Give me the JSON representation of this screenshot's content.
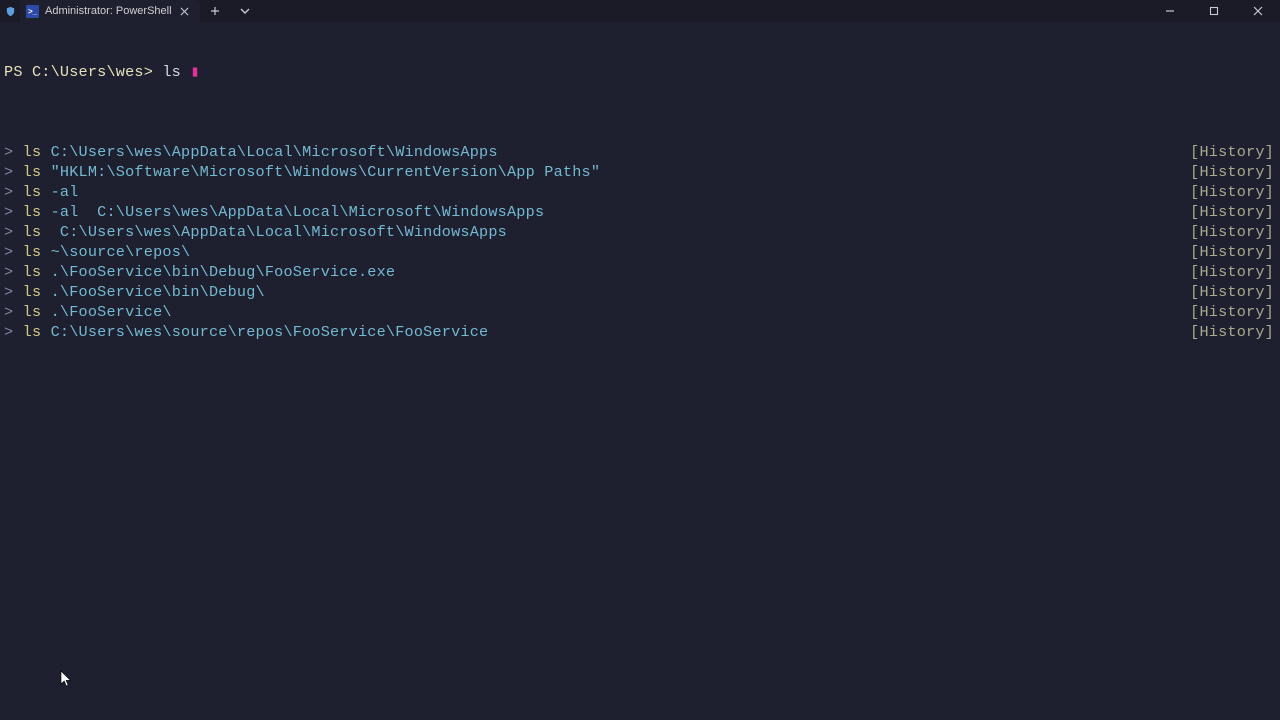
{
  "titlebar": {
    "tab_title": "Administrator: PowerShell",
    "ps_icon_glyph": ">_"
  },
  "terminal": {
    "prompt_text": "PS C:\\Users\\wes>",
    "typed_text": "ls",
    "cursor_glyph": "▮",
    "history_tag": "[History]",
    "suggestions": [
      {
        "cmd": "ls",
        "arg": " C:\\Users\\wes\\AppData\\Local\\Microsoft\\WindowsApps"
      },
      {
        "cmd": "ls",
        "arg": " \"HKLM:\\Software\\Microsoft\\Windows\\CurrentVersion\\App Paths\""
      },
      {
        "cmd": "ls",
        "arg": " -al"
      },
      {
        "cmd": "ls",
        "arg": " -al  C:\\Users\\wes\\AppData\\Local\\Microsoft\\WindowsApps"
      },
      {
        "cmd": "ls",
        "arg": "  C:\\Users\\wes\\AppData\\Local\\Microsoft\\WindowsApps"
      },
      {
        "cmd": "ls",
        "arg": " ~\\source\\repos\\"
      },
      {
        "cmd": "ls",
        "arg": " .\\FooService\\bin\\Debug\\FooService.exe"
      },
      {
        "cmd": "ls",
        "arg": " .\\FooService\\bin\\Debug\\"
      },
      {
        "cmd": "ls",
        "arg": " .\\FooService\\"
      },
      {
        "cmd": "ls",
        "arg": " C:\\Users\\wes\\source\\repos\\FooService\\FooService"
      }
    ]
  }
}
